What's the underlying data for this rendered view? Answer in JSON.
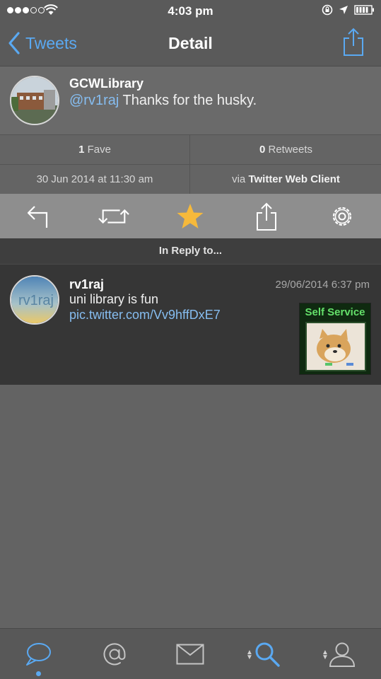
{
  "status_bar": {
    "time": "4:03 pm"
  },
  "nav": {
    "back_label": "Tweets",
    "title": "Detail"
  },
  "tweet": {
    "user": "GCWLibrary",
    "mention": "@rv1raj",
    "text": " Thanks for the husky."
  },
  "stats": {
    "faves_count": "1",
    "faves_label": " Fave",
    "retweets_count": "0",
    "retweets_label": " Retweets",
    "date": "30 Jun 2014 at 11:30 am",
    "via_prefix": "via ",
    "client": "Twitter Web Client"
  },
  "actions": [
    "reply-icon",
    "retweet-icon",
    "star-icon",
    "share-icon",
    "gear-icon"
  ],
  "reply_header": "In Reply to...",
  "reply": {
    "user": "rv1raj",
    "date": "29/06/2014 6:37 pm",
    "text": "uni library is fun ",
    "link": "pic.twitter.com/Vv9hffDxE7",
    "avatar_text": "rv1raj",
    "thumb_title": "Self Service"
  },
  "tabs": [
    "speech-bubble-icon",
    "at-icon",
    "mail-icon",
    "search-icon",
    "profile-icon"
  ],
  "colors": {
    "accent": "#5aa9f2",
    "star": "#f6b93b",
    "link": "#86bdf0"
  }
}
